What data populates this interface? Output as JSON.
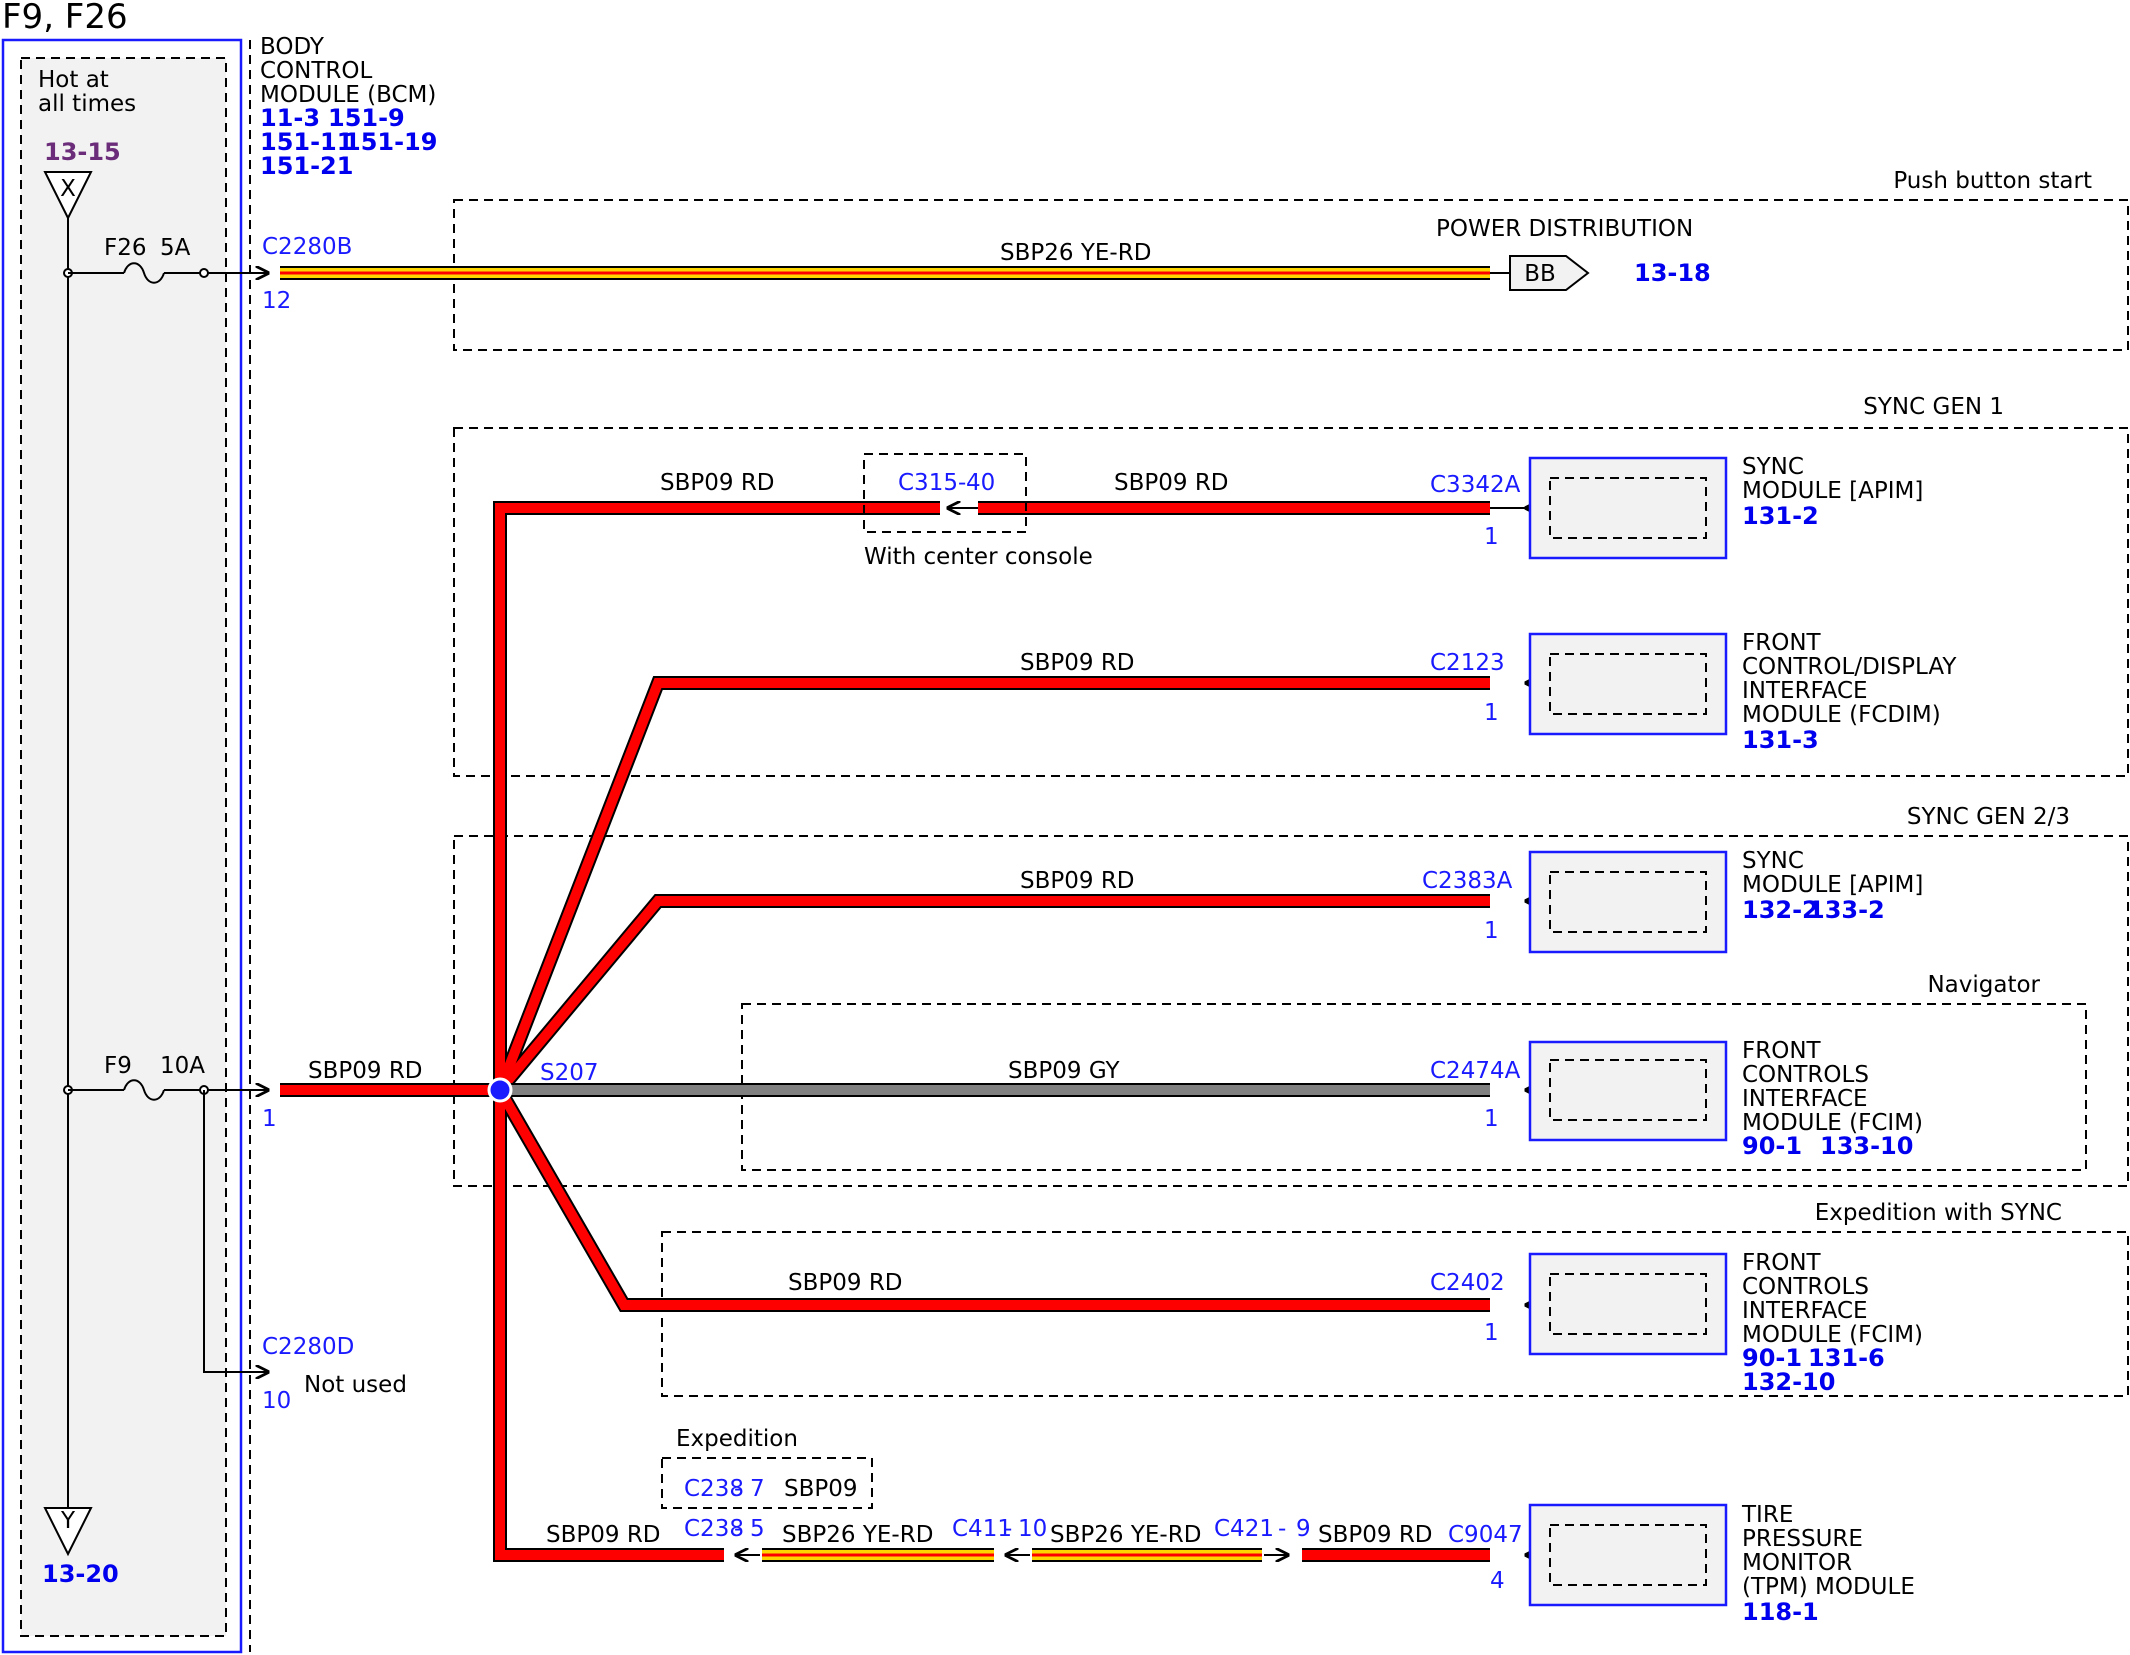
{
  "title": "F9, F26",
  "left_panel": {
    "hot_label_line1": "Hot at",
    "hot_label_line2": "all times",
    "top_ref": "13-15",
    "top_marker": "X",
    "bottom_marker": "Y",
    "bottom_ref": "13-20",
    "fuse_f26": "F26",
    "fuse_f26_rating": "5A",
    "fuse_f9": "F9",
    "fuse_f9_rating": "10A"
  },
  "bcm": {
    "line1": "BODY",
    "line2": "CONTROL",
    "line3": "MODULE (BCM)",
    "refs_row1": [
      "11-3",
      "151-9"
    ],
    "refs_row2": [
      "151-11",
      "151-19"
    ],
    "refs_row3": [
      "151-21"
    ]
  },
  "connectors": {
    "c2280b": "C2280B",
    "c2280b_pin": "12",
    "c2280d_pin1": "1",
    "c2280d": "C2280D",
    "c2280d_pin10": "10",
    "not_used": "Not used",
    "splice": "S207"
  },
  "groups": {
    "push_button": "Push button start",
    "sync_gen1": "SYNC GEN 1",
    "sync_gen23": "SYNC GEN 2/3",
    "navigator": "Navigator",
    "expedition_sync": "Expedition with SYNC",
    "expedition": "Expedition",
    "center_console": "With center console"
  },
  "circuits": {
    "sbp26_yerd": "SBP26  YE-RD",
    "sbp09_rd": "SBP09  RD",
    "sbp09_gy": "SBP09  GY",
    "sbp09": "SBP09"
  },
  "power_distribution": {
    "label": "POWER DISTRIBUTION",
    "marker": "BB",
    "ref": "13-18"
  },
  "inline_connectors": {
    "c315": "C315",
    "c315_pin": "40",
    "c2387": "C238",
    "c2387_pin": "7",
    "c2385": "C238",
    "c2385_pin": "5",
    "c411": "C411",
    "c411_pin": "10",
    "c421": "C421",
    "c421_pin": "9",
    "dash": "-"
  },
  "modules": [
    {
      "connector": "C3342A",
      "pin": "1",
      "lines": [
        "SYNC",
        "MODULE [APIM]"
      ],
      "refs": [
        "131-2"
      ]
    },
    {
      "connector": "C2123",
      "pin": "1",
      "lines": [
        "FRONT",
        "CONTROL/DISPLAY",
        "INTERFACE",
        "MODULE (FCDIM)"
      ],
      "refs": [
        "131-3"
      ]
    },
    {
      "connector": "C2383A",
      "pin": "1",
      "lines": [
        "SYNC",
        "MODULE [APIM]"
      ],
      "refs": [
        "132-2",
        "133-2"
      ]
    },
    {
      "connector": "C2474A",
      "pin": "1",
      "lines": [
        "FRONT",
        "CONTROLS",
        "INTERFACE",
        "MODULE (FCIM)"
      ],
      "refs": [
        "90-1",
        "133-10"
      ]
    },
    {
      "connector": "C2402",
      "pin": "1",
      "lines": [
        "FRONT",
        "CONTROLS",
        "INTERFACE",
        "MODULE (FCIM)"
      ],
      "refs": [
        "90-1",
        "131-6",
        "132-10"
      ]
    },
    {
      "connector": "C9047",
      "pin": "4",
      "lines": [
        "TIRE",
        "PRESSURE",
        "MONITOR",
        "(TPM) MODULE"
      ],
      "refs": [
        "118-1"
      ]
    }
  ],
  "colors": {
    "red_wire": "#ff0000",
    "gray_wire": "#808080",
    "yellow_stripe": "#ffd700",
    "connector_blue": "#1a1aff",
    "ref_blue": "#0000ee",
    "ref_purple": "#6b2d7a",
    "panel_fill": "#f2f2f2"
  }
}
